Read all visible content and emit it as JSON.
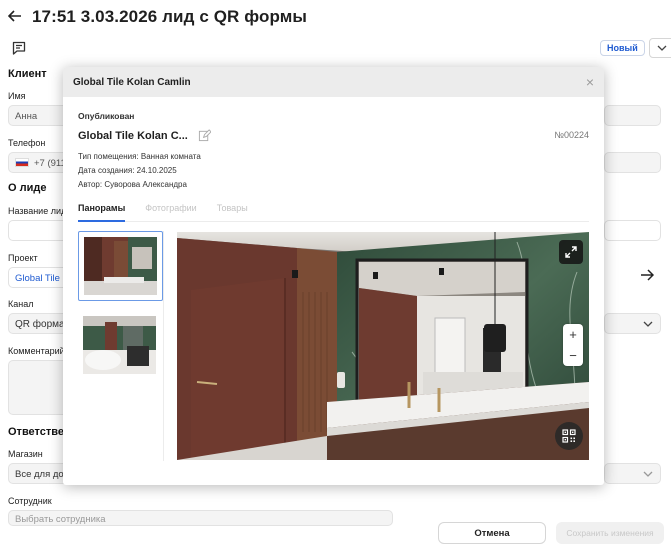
{
  "page": {
    "title": "17:51 3.03.2026 лид с QR формы",
    "status": "Новый"
  },
  "client": {
    "heading": "Клиент",
    "name_label": "Имя",
    "name_value": "Анна",
    "phone_label": "Телефон",
    "phone_value": "+7 (911"
  },
  "lead": {
    "heading": "О лиде",
    "name_label": "Название лид",
    "project_label": "Проект",
    "project_value": "Global Tile Ko",
    "channel_label": "Канал",
    "channel_value": "QR форма",
    "comment_label": "Комментарий"
  },
  "responsible": {
    "heading": "Ответственн",
    "shop_label": "Магазин",
    "shop_value": "Все для до",
    "employee_label": "Сотрудник",
    "employee_placeholder": "Выбрать сотрудника"
  },
  "actions": {
    "cancel": "Отмена",
    "save": "Сохранить изменения"
  },
  "modal": {
    "title": "Global Tile Kolan Camlin",
    "close": "×",
    "status": "Опубликован",
    "name": "Global Tile Kolan C...",
    "number": "№00224",
    "room_type": "Тип помещения: Ванная комната",
    "created": "Дата создания: 24.10.2025",
    "author": "Автор: Суворова Александра",
    "tabs": [
      {
        "label": "Панорамы",
        "active": true
      },
      {
        "label": "Фотографии",
        "active": false
      },
      {
        "label": "Товары",
        "active": false
      }
    ],
    "zoom_in": "+",
    "zoom_out": "−"
  },
  "colors": {
    "accent": "#2d6be0",
    "link": "#1f5bd1",
    "marble_green": "#3f5b48",
    "wall_brown": "#6e3d33"
  },
  "icons": [
    "back-arrow-icon",
    "chat-icon",
    "chevron-down-icon",
    "edit-icon",
    "close-icon",
    "expand-icon",
    "qr-code-icon",
    "arrow-right-icon"
  ]
}
